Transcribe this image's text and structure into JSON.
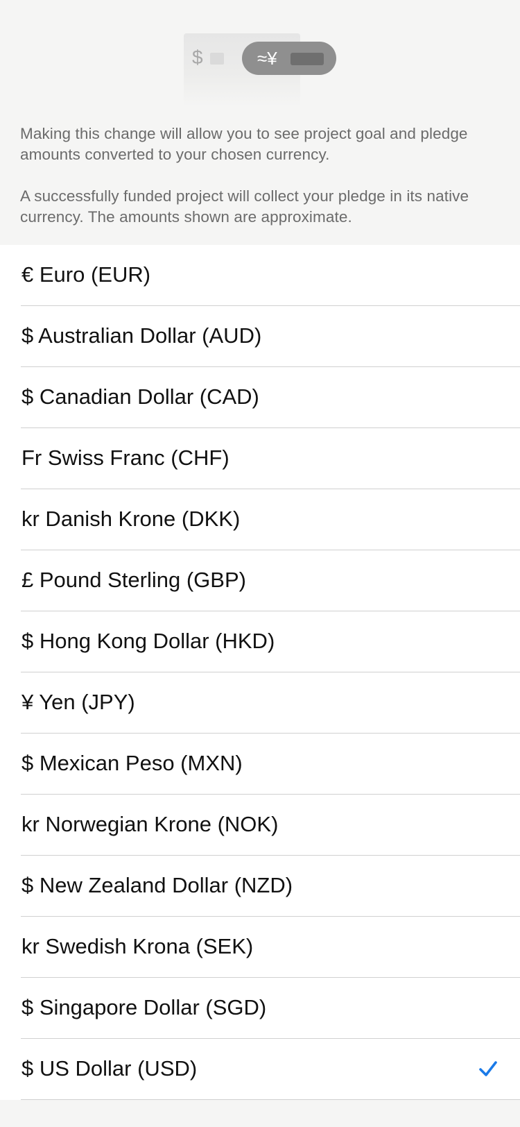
{
  "illustration": {
    "left_symbol": "$",
    "pill_text": "≈¥"
  },
  "description": {
    "paragraph1": "Making this change will allow you to see project goal and pledge amounts converted to your chosen currency.",
    "paragraph2": "A successfully funded project will collect your pledge in its native currency. The amounts shown are approximate."
  },
  "currencies": [
    {
      "label": "€ Euro (EUR)",
      "selected": false
    },
    {
      "label": "$ Australian Dollar (AUD)",
      "selected": false
    },
    {
      "label": "$ Canadian Dollar (CAD)",
      "selected": false
    },
    {
      "label": "Fr Swiss Franc (CHF)",
      "selected": false
    },
    {
      "label": "kr Danish Krone (DKK)",
      "selected": false
    },
    {
      "label": "£ Pound Sterling (GBP)",
      "selected": false
    },
    {
      "label": "$ Hong Kong Dollar (HKD)",
      "selected": false
    },
    {
      "label": "¥ Yen (JPY)",
      "selected": false
    },
    {
      "label": "$ Mexican Peso (MXN)",
      "selected": false
    },
    {
      "label": "kr Norwegian Krone (NOK)",
      "selected": false
    },
    {
      "label": "$ New Zealand Dollar (NZD)",
      "selected": false
    },
    {
      "label": "kr Swedish Krona (SEK)",
      "selected": false
    },
    {
      "label": "$ Singapore Dollar (SGD)",
      "selected": false
    },
    {
      "label": "$ US Dollar (USD)",
      "selected": true
    }
  ],
  "colors": {
    "accent": "#1a7ae8",
    "background": "#f5f5f4",
    "list_background": "#ffffff",
    "separator": "#d0d0d0",
    "secondary_text": "#6b6b6b"
  },
  "icons": {
    "selected": "checkmark-icon"
  }
}
